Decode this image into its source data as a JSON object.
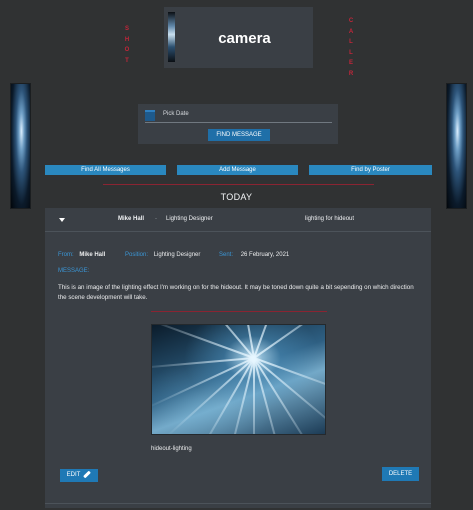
{
  "header": {
    "title": "camera"
  },
  "side_labels": {
    "left": "SHOT",
    "right": "CALLER"
  },
  "date_picker": {
    "label": "Pick Date",
    "button": "FIND MESSAGE"
  },
  "actions": {
    "find_all": "Find All Messages",
    "add": "Add Message",
    "find_by_poster": "Find by Poster"
  },
  "today": "TODAY",
  "message": {
    "summary": {
      "name": "Mike Hall",
      "separator": "-",
      "position": "Lighting Designer",
      "subject": "lighting for hideout"
    },
    "from_label": "From:",
    "from": "Mike Hall",
    "position_label": "Position:",
    "position": "Lighting Designer",
    "sent_label": "Sent:",
    "sent": "26 February, 2021",
    "message_label": "MESSAGE:",
    "body": "This is an image of the lighting effect I'm working on for the hideout. It may be toned down quite a bit sepending on which direction the scene development will take.",
    "image_caption": "hideout-lighting",
    "edit_button": "EDIT",
    "delete_button": "DELETE"
  },
  "colors": {
    "accent": "#1f79b5",
    "rule": "#8a2432",
    "label": "#3a96d6",
    "vertical_text": "#c2263a"
  },
  "icons": [
    "calendar-icon",
    "caret-down-icon",
    "pencil-icon"
  ]
}
